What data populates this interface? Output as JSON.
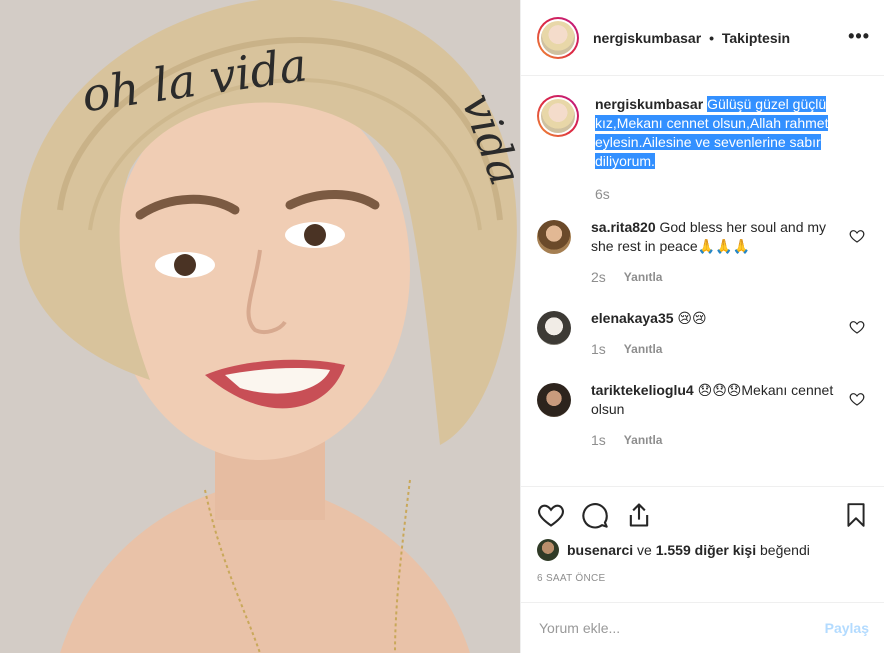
{
  "post": {
    "username": "nergiskumbasar",
    "separator": "•",
    "follow_status": "Takiptesin",
    "more": "•••",
    "hat_text_left": "oh la vida",
    "hat_text_right": "vida"
  },
  "caption": {
    "username": "nergiskumbasar",
    "text": "Gülüşü güzel güçlü kız,Mekanı cennet olsun,Allah rahmet eylesin.Ailesine ve sevenlerine sabır diliyorum.",
    "time": "6s"
  },
  "comments": [
    {
      "username": "sa.rita820",
      "text": "God bless her soul and my she rest in peace🙏🙏🙏",
      "time": "2s",
      "reply": "Yanıtla"
    },
    {
      "username": "elenakaya35",
      "text": "😢😢",
      "time": "1s",
      "reply": "Yanıtla"
    },
    {
      "username": "tariktekelioglu4",
      "text": "😞😞😞Mekanı cennet olsun",
      "time": "1s",
      "reply": "Yanıtla"
    }
  ],
  "likes": {
    "user": "busenarci",
    "connector": "ve",
    "others": "1.559 diğer kişi",
    "suffix": "beğendi"
  },
  "timestamp": "6 SAAT ÖNCE",
  "add_comment": {
    "placeholder": "Yorum ekle...",
    "post_label": "Paylaş"
  },
  "colors": {
    "highlight": "#3390ff",
    "post_disabled": "#b3dbff",
    "muted": "#8e8e8e"
  }
}
